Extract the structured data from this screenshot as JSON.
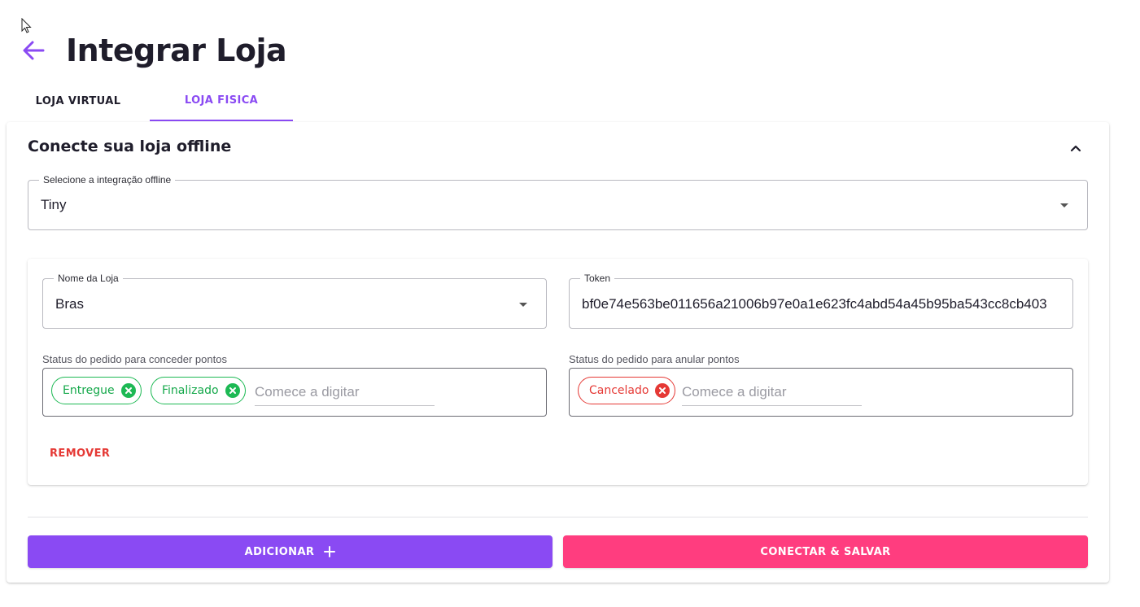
{
  "page": {
    "title": "Integrar Loja"
  },
  "tabs": [
    {
      "label": "LOJA VIRTUAL"
    },
    {
      "label": "LOJA FISICA"
    }
  ],
  "card": {
    "title": "Conecte sua loja offline",
    "integration_select": {
      "label": "Selecione a integração offline",
      "value": "Tiny"
    }
  },
  "store": {
    "name_select": {
      "label": "Nome da Loja",
      "value": "Bras"
    },
    "token": {
      "label": "Token",
      "value": "bf0e74e563be011656a21006b97e0a1e623fc4abd54a45b95ba543cc8cb403"
    },
    "grant_status": {
      "label": "Status do pedido para conceder pontos",
      "chips": [
        "Entregue",
        "Finalizado"
      ],
      "placeholder": "Comece a digitar"
    },
    "cancel_status": {
      "label": "Status do pedido para anular pontos",
      "chips": [
        "Cancelado"
      ],
      "placeholder": "Comece a digitar"
    },
    "remove_label": "REMOVER"
  },
  "actions": {
    "add_label": "ADICIONAR",
    "save_label": "CONECTAR & SALVAR"
  },
  "colors": {
    "primary": "#8a4af3",
    "accent": "#ff3d7f",
    "success": "#1db954",
    "danger": "#e53935"
  },
  "icons": {
    "back": "arrow-left-icon",
    "collapse": "chevron-up-icon",
    "dropdown": "caret-down-icon",
    "chip_delete": "close-circle-icon",
    "add": "plus-icon"
  }
}
